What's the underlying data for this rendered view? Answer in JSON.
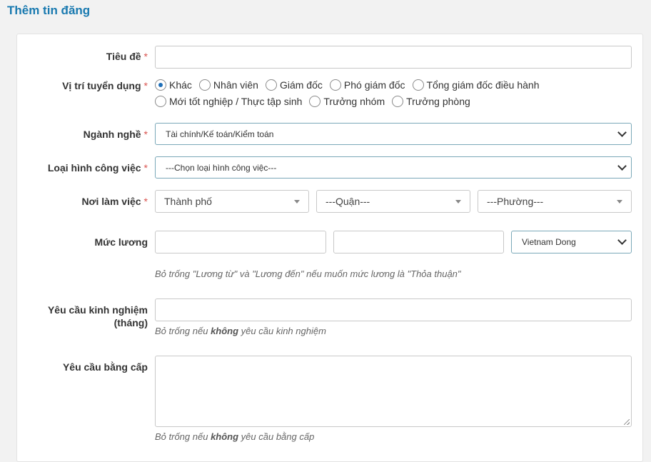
{
  "header": {
    "title": "Thêm tin đăng"
  },
  "required_mark": "*",
  "form": {
    "title": {
      "label": "Tiêu đề",
      "value": ""
    },
    "position": {
      "label": "Vị trí tuyển dụng",
      "options": [
        "Khác",
        "Nhân viên",
        "Giám đốc",
        "Phó giám đốc",
        "Tổng giám đốc điều hành",
        "Mới tốt nghiệp / Thực tập sinh",
        "Trưởng nhóm",
        "Trưởng phòng"
      ],
      "selected": "Khác"
    },
    "industry": {
      "label": "Ngành nghề",
      "selected": "Tài chính/Kế toán/Kiểm toán"
    },
    "job_type": {
      "label": "Loại hình công việc",
      "selected": "---Chọn loại hình công việc---"
    },
    "workplace": {
      "label": "Nơi làm việc",
      "city": "Thành phố",
      "district": "---Quận---",
      "ward": "---Phường---"
    },
    "salary": {
      "label": "Mức lương",
      "from_value": "",
      "to_value": "",
      "currency": "Vietnam Dong",
      "hint": "Bỏ trống \"Lương từ\" và \"Lương đến\" nếu muốn mức lương là \"Thỏa thuận\""
    },
    "experience": {
      "label_line1": "Yêu cầu kinh nghiệm",
      "label_line2": "(tháng)",
      "value": "",
      "hint_prefix": "Bỏ trống nếu ",
      "hint_bold": "không",
      "hint_suffix": " yêu cầu kinh nghiệm"
    },
    "degree": {
      "label": "Yêu cầu bằng cấp",
      "value": "",
      "hint_prefix": "Bỏ trống nếu ",
      "hint_bold": "không",
      "hint_suffix": " yêu cầu bằng cấp"
    }
  }
}
